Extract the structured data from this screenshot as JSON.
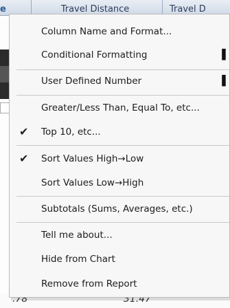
{
  "table": {
    "header_partial": "e",
    "header_travel_distance": "Travel Distance",
    "header_travel_partial": "Travel D",
    "bottom_row": {
      "c1": ".78",
      "c2": "31.47"
    }
  },
  "menu": {
    "items": [
      {
        "label": "Column Name and Format...",
        "checked": false,
        "submenu": false
      },
      {
        "label": "Conditional Formatting",
        "checked": false,
        "submenu": true
      },
      {
        "label": "User Defined Number",
        "checked": false,
        "submenu": true
      },
      {
        "label": "Greater/Less Than, Equal To, etc...",
        "checked": false,
        "submenu": false
      },
      {
        "label": "Top 10, etc...",
        "checked": true,
        "submenu": false
      },
      {
        "label": "Sort Values High→Low",
        "checked": true,
        "submenu": false
      },
      {
        "label": "Sort Values Low→High",
        "checked": false,
        "submenu": false
      },
      {
        "label": "Subtotals (Sums, Averages, etc.)",
        "checked": false,
        "submenu": false
      },
      {
        "label": "Tell me about...",
        "checked": false,
        "submenu": false
      },
      {
        "label": "Hide from Chart",
        "checked": false,
        "submenu": false
      },
      {
        "label": "Remove from Report",
        "checked": false,
        "submenu": false
      }
    ],
    "check_glyph": "✔",
    "submenu_glyph": "▌"
  }
}
